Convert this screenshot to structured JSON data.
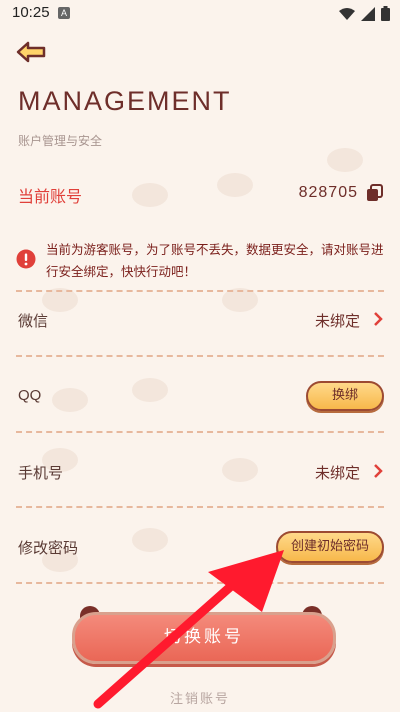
{
  "status_bar": {
    "time": "10:25",
    "notification_glyph": "A"
  },
  "header": {
    "title": "MANAGEMENT",
    "subtitle": "账户管理与安全"
  },
  "account": {
    "label": "当前账号",
    "value": "828705"
  },
  "warning": {
    "text": "当前为游客账号，为了账号不丢失，数据更安全，请对账号进行安全绑定，快快行动吧！"
  },
  "rows": {
    "wechat": {
      "label": "微信",
      "status": "未绑定"
    },
    "qq": {
      "label": "QQ",
      "button": "换绑"
    },
    "phone": {
      "label": "手机号",
      "status": "未绑定"
    },
    "password": {
      "label": "修改密码",
      "button": "创建初始密码"
    }
  },
  "footer": {
    "switch_button": "切换账号",
    "cancel_link": "注销账号"
  },
  "colors": {
    "accent_red": "#e0403a",
    "button_yellow": "#f7b84b",
    "bottom_button": "#ea6756",
    "annotation_arrow": "#ff1a2e"
  },
  "icons": [
    "back-arrow-icon",
    "copy-icon",
    "warning-icon",
    "chevron-right-icon",
    "wifi-icon",
    "signal-icon",
    "battery-icon"
  ]
}
